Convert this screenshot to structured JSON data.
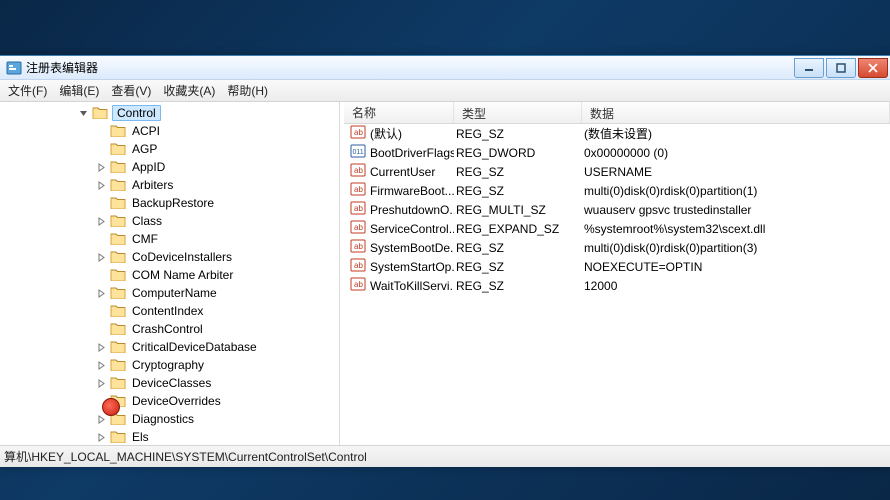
{
  "window": {
    "title": "注册表编辑器"
  },
  "menus": [
    "文件(F)",
    "编辑(E)",
    "查看(V)",
    "收藏夹(A)",
    "帮助(H)"
  ],
  "tree": {
    "selected": "Control",
    "items": [
      {
        "depth": 3,
        "expander": "open",
        "label": "Control",
        "selected": true
      },
      {
        "depth": 4,
        "expander": "none",
        "label": "ACPI"
      },
      {
        "depth": 4,
        "expander": "none",
        "label": "AGP"
      },
      {
        "depth": 4,
        "expander": "closed",
        "label": "AppID"
      },
      {
        "depth": 4,
        "expander": "closed",
        "label": "Arbiters"
      },
      {
        "depth": 4,
        "expander": "none",
        "label": "BackupRestore"
      },
      {
        "depth": 4,
        "expander": "closed",
        "label": "Class"
      },
      {
        "depth": 4,
        "expander": "none",
        "label": "CMF"
      },
      {
        "depth": 4,
        "expander": "closed",
        "label": "CoDeviceInstallers"
      },
      {
        "depth": 4,
        "expander": "none",
        "label": "COM Name Arbiter"
      },
      {
        "depth": 4,
        "expander": "closed",
        "label": "ComputerName"
      },
      {
        "depth": 4,
        "expander": "none",
        "label": "ContentIndex"
      },
      {
        "depth": 4,
        "expander": "none",
        "label": "CrashControl"
      },
      {
        "depth": 4,
        "expander": "closed",
        "label": "CriticalDeviceDatabase"
      },
      {
        "depth": 4,
        "expander": "closed",
        "label": "Cryptography"
      },
      {
        "depth": 4,
        "expander": "closed",
        "label": "DeviceClasses"
      },
      {
        "depth": 4,
        "expander": "none",
        "label": "DeviceOverrides"
      },
      {
        "depth": 4,
        "expander": "closed",
        "label": "Diagnostics"
      },
      {
        "depth": 4,
        "expander": "closed",
        "label": "Els"
      }
    ]
  },
  "list": {
    "columns": {
      "name": "名称",
      "type": "类型",
      "data": "数据"
    },
    "rows": [
      {
        "icon": "sz",
        "name": "(默认)",
        "type": "REG_SZ",
        "data": "(数值未设置)"
      },
      {
        "icon": "bin",
        "name": "BootDriverFlags",
        "type": "REG_DWORD",
        "data": "0x00000000 (0)"
      },
      {
        "icon": "sz",
        "name": "CurrentUser",
        "type": "REG_SZ",
        "data": "USERNAME"
      },
      {
        "icon": "sz",
        "name": "FirmwareBoot...",
        "type": "REG_SZ",
        "data": "multi(0)disk(0)rdisk(0)partition(1)"
      },
      {
        "icon": "sz",
        "name": "PreshutdownO...",
        "type": "REG_MULTI_SZ",
        "data": "wuauserv gpsvc trustedinstaller"
      },
      {
        "icon": "sz",
        "name": "ServiceControl...",
        "type": "REG_EXPAND_SZ",
        "data": "%systemroot%\\system32\\scext.dll"
      },
      {
        "icon": "sz",
        "name": "SystemBootDe...",
        "type": "REG_SZ",
        "data": "multi(0)disk(0)rdisk(0)partition(3)"
      },
      {
        "icon": "sz",
        "name": "SystemStartOp...",
        "type": "REG_SZ",
        "data": " NOEXECUTE=OPTIN"
      },
      {
        "icon": "sz",
        "name": "WaitToKillServi...",
        "type": "REG_SZ",
        "data": "12000"
      }
    ]
  },
  "status": "算机\\HKEY_LOCAL_MACHINE\\SYSTEM\\CurrentControlSet\\Control"
}
